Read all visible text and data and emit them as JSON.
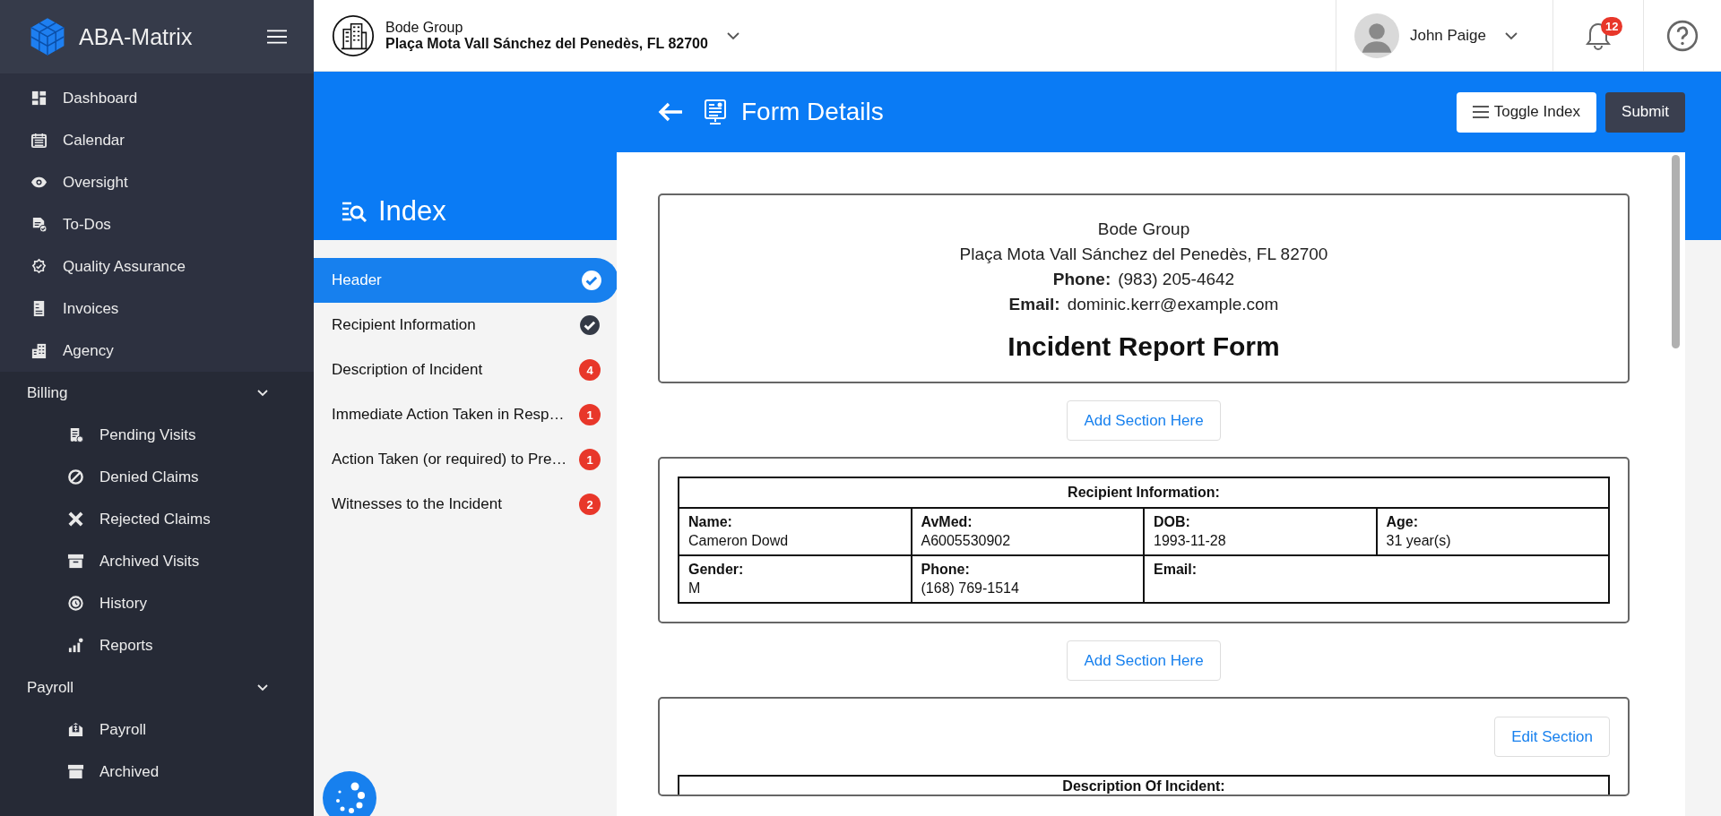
{
  "sidebar": {
    "brand": "ABA-Matrix",
    "nav": [
      {
        "label": "Dashboard"
      },
      {
        "label": "Calendar"
      },
      {
        "label": "Oversight"
      },
      {
        "label": "To-Dos"
      },
      {
        "label": "Quality Assurance"
      },
      {
        "label": "Invoices"
      },
      {
        "label": "Agency"
      }
    ],
    "groups": [
      {
        "label": "Billing",
        "expanded": true,
        "items": [
          {
            "label": "Pending Visits"
          },
          {
            "label": "Denied Claims"
          },
          {
            "label": "Rejected Claims"
          },
          {
            "label": "Archived Visits"
          },
          {
            "label": "History"
          },
          {
            "label": "Reports"
          }
        ]
      },
      {
        "label": "Payroll",
        "expanded": true,
        "items": [
          {
            "label": "Payroll"
          },
          {
            "label": "Archived"
          }
        ]
      }
    ]
  },
  "topbar": {
    "org_name": "Bode Group",
    "org_address": "Plaça Mota Vall Sánchez del Penedès, FL 82700",
    "user_name": "John Paige",
    "notification_count": "12"
  },
  "page_header": {
    "title": "Form Details",
    "buttons": [
      {
        "label": "Toggle Index",
        "kind": "secondary"
      },
      {
        "label": "Submit",
        "kind": "primary"
      }
    ]
  },
  "index": {
    "title": "Index",
    "items": [
      {
        "label": "Header",
        "selected": true,
        "kind": "check"
      },
      {
        "label": "Recipient Information",
        "selected": false,
        "kind": "check"
      },
      {
        "label": "Description of Incident",
        "selected": false,
        "kind": "count",
        "count": "4"
      },
      {
        "label": "Immediate Action Taken in Resp…",
        "selected": false,
        "kind": "count",
        "count": "1"
      },
      {
        "label": "Action Taken (or required) to Pre…",
        "selected": false,
        "kind": "count",
        "count": "1"
      },
      {
        "label": "Witnesses to the Incident",
        "selected": false,
        "kind": "count",
        "count": "2"
      }
    ]
  },
  "form": {
    "header": {
      "company": "Bode Group",
      "address": "Plaça Mota Vall Sánchez del Penedès, FL 82700",
      "phone_label": "Phone:",
      "phone": "(983) 205-4642",
      "email_label": "Email:",
      "email": "dominic.kerr@example.com",
      "title": "Incident Report Form"
    },
    "add_section_buttons": [
      "Add Section Here",
      "Add Section Here"
    ],
    "recipient_table": {
      "title": "Recipient Information:",
      "rows": [
        [
          {
            "label": "Name:",
            "value": "Cameron Dowd"
          },
          {
            "label": "AvMed:",
            "value": "A6005530902"
          },
          {
            "label": "DOB:",
            "value": "1993-11-28"
          },
          {
            "label": "Age:",
            "value": "31 year(s)"
          }
        ],
        [
          {
            "label": "Gender:",
            "value": "M"
          },
          {
            "label": "Phone:",
            "value": "(168) 769-1514"
          },
          {
            "label": "Email:",
            "colspan": 2
          }
        ]
      ]
    },
    "description_section": {
      "edit_button": "Edit Section",
      "table_title": "Description Of Incident:"
    }
  }
}
